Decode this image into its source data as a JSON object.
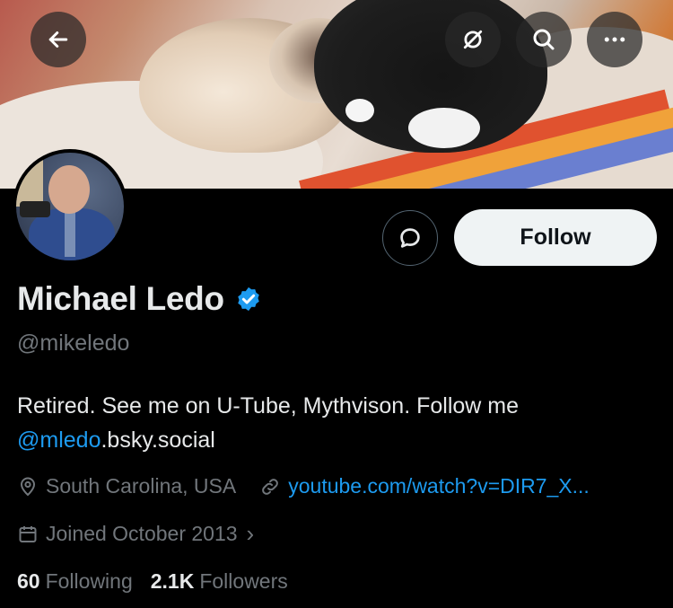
{
  "header": {
    "back_icon": "arrow-left-icon",
    "translate_icon": "no-signal-icon",
    "search_icon": "search-icon",
    "more_icon": "more-dots-icon"
  },
  "profile": {
    "name": "Michael Ledo",
    "handle": "@mikeledo",
    "verified": true,
    "bio_text": "Retired. See me on U-Tube, Mythvison. Follow me",
    "bio_mention": "@mledo",
    "bio_rest": ".bsky.social",
    "location": "South Carolina, USA",
    "link": "youtube.com/watch?v=DIR7_X...",
    "joined": "Joined October 2013",
    "joined_chevron": "›"
  },
  "actions": {
    "follow_label": "Follow",
    "message_icon": "message-bubble-icon"
  },
  "stats": {
    "following_count": "60",
    "following_label": "Following",
    "followers_count": "2.1K",
    "followers_label": "Followers"
  },
  "colors": {
    "accent": "#1d9bf0",
    "muted": "#71767b",
    "text": "#e7e9ea",
    "background": "#000000",
    "follow_bg": "#eff3f4"
  }
}
